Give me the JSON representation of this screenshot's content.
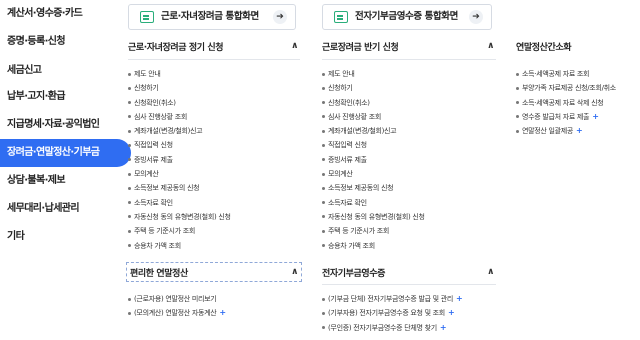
{
  "sidebar": {
    "items": [
      {
        "label": "계산서·영수증·카드"
      },
      {
        "label": "증명·등록·신청"
      },
      {
        "label": "세금신고"
      },
      {
        "label": "납부·고지·환급"
      },
      {
        "label": "지급명세·자료·공익법인"
      },
      {
        "label": "장려금·연말정산·기부금"
      },
      {
        "label": "상담·불복·제보"
      },
      {
        "label": "세무대리·납세관리"
      },
      {
        "label": "기타"
      }
    ]
  },
  "top_buttons": {
    "left": {
      "label": "근로·자녀장려금 통합화면"
    },
    "middle": {
      "label": "전자기부금영수증 통합화면"
    }
  },
  "columns": {
    "col1": {
      "title": "근로·자녀장려금 정기 신청",
      "items": [
        "제도 안내",
        "신청하기",
        "신청확인(취소)",
        "심사 진행상황 조회",
        "계좌개설(변경/철회)신고",
        "직접입력 신청",
        "증빙서류 제출",
        "모의계산",
        "소득정보 제공동의 신청",
        "소득자료 확인",
        "자동신청 동의 유형변경(철회) 신청",
        "주택 등 기준시가 조회",
        "승용차 가액 조회"
      ]
    },
    "col2": {
      "title": "근로장려금 반기 신청",
      "items": [
        "제도 안내",
        "신청하기",
        "신청확인(취소)",
        "심사 진행상황 조회",
        "계좌개설(변경/철회)신고",
        "직접입력 신청",
        "증빙서류 제출",
        "모의계산",
        "소득정보 제공동의 신청",
        "소득자료 확인",
        "자동신청 동의 유형변경(철회) 신청",
        "주택 등 기준시가 조회",
        "승용차 가액 조회"
      ]
    },
    "col3": {
      "title": "연말정산간소화",
      "items": [
        {
          "text": "소득·세액공제 자료 조회",
          "plus": ""
        },
        {
          "text": "부양가족 자료제공 신청/조회/취소",
          "plus": ""
        },
        {
          "text": "소득·세액공제 자료 삭제 신청",
          "plus": ""
        },
        {
          "text": "영수증 발급처 자료 제출",
          "plus": "+"
        },
        {
          "text": "연말정산 일괄제공",
          "plus": "+"
        }
      ]
    },
    "col1b": {
      "title": "편리한 연말정산",
      "items": [
        {
          "text": "(근로자용) 연말정산 미리보기",
          "plus": ""
        },
        {
          "text": "(모의계산) 연말정산 자동계산",
          "plus": "+"
        }
      ]
    },
    "col2b": {
      "title": "전자기부금영수증",
      "items": [
        {
          "text": "(기부금 단체) 전자기부금영수증 발급 및 관리",
          "plus": "+"
        },
        {
          "text": "(기부자용) 전자기부금영수증 요청 및 조회",
          "plus": "+"
        },
        {
          "text": "(무인증) 전자기부금영수증 단체명 찾기",
          "plus": "+"
        }
      ]
    }
  },
  "icons": {
    "chevron": "chevron-up-icon",
    "arrow": "arrow-right-icon",
    "document": "document-icon"
  },
  "colors": {
    "accent": "#2F6DF2",
    "icon_green": "#2AAE7B"
  }
}
